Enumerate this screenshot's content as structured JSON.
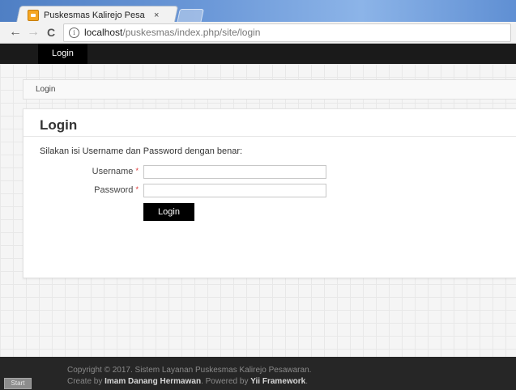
{
  "browser": {
    "tab_title": "Puskesmas Kalirejo Pesa",
    "tab_close": "×",
    "url_host": "localhost",
    "url_path": "/puskesmas/index.php/site/login",
    "back_icon": "←",
    "forward_icon": "→",
    "reload_icon": "C",
    "info_icon": "i"
  },
  "navbar": {
    "login_label": "Login"
  },
  "breadcrumb": {
    "label": "Login"
  },
  "panel": {
    "title": "Login",
    "description": "Silakan isi Username dan Password dengan benar:",
    "username_label": "Username",
    "password_label": "Password",
    "required_mark": "*",
    "username_value": "",
    "password_value": "",
    "submit_label": "Login"
  },
  "footer": {
    "copyright": "Copyright © 2017. Sistem Layanan Puskesmas Kalirejo Pesawaran.",
    "created_prefix": "Create by ",
    "author": "Imam Danang Hermawan",
    "powered_prefix": ". Powered by ",
    "framework": "Yii Framework",
    "suffix": "."
  },
  "taskbar": {
    "start_label": "Start"
  }
}
